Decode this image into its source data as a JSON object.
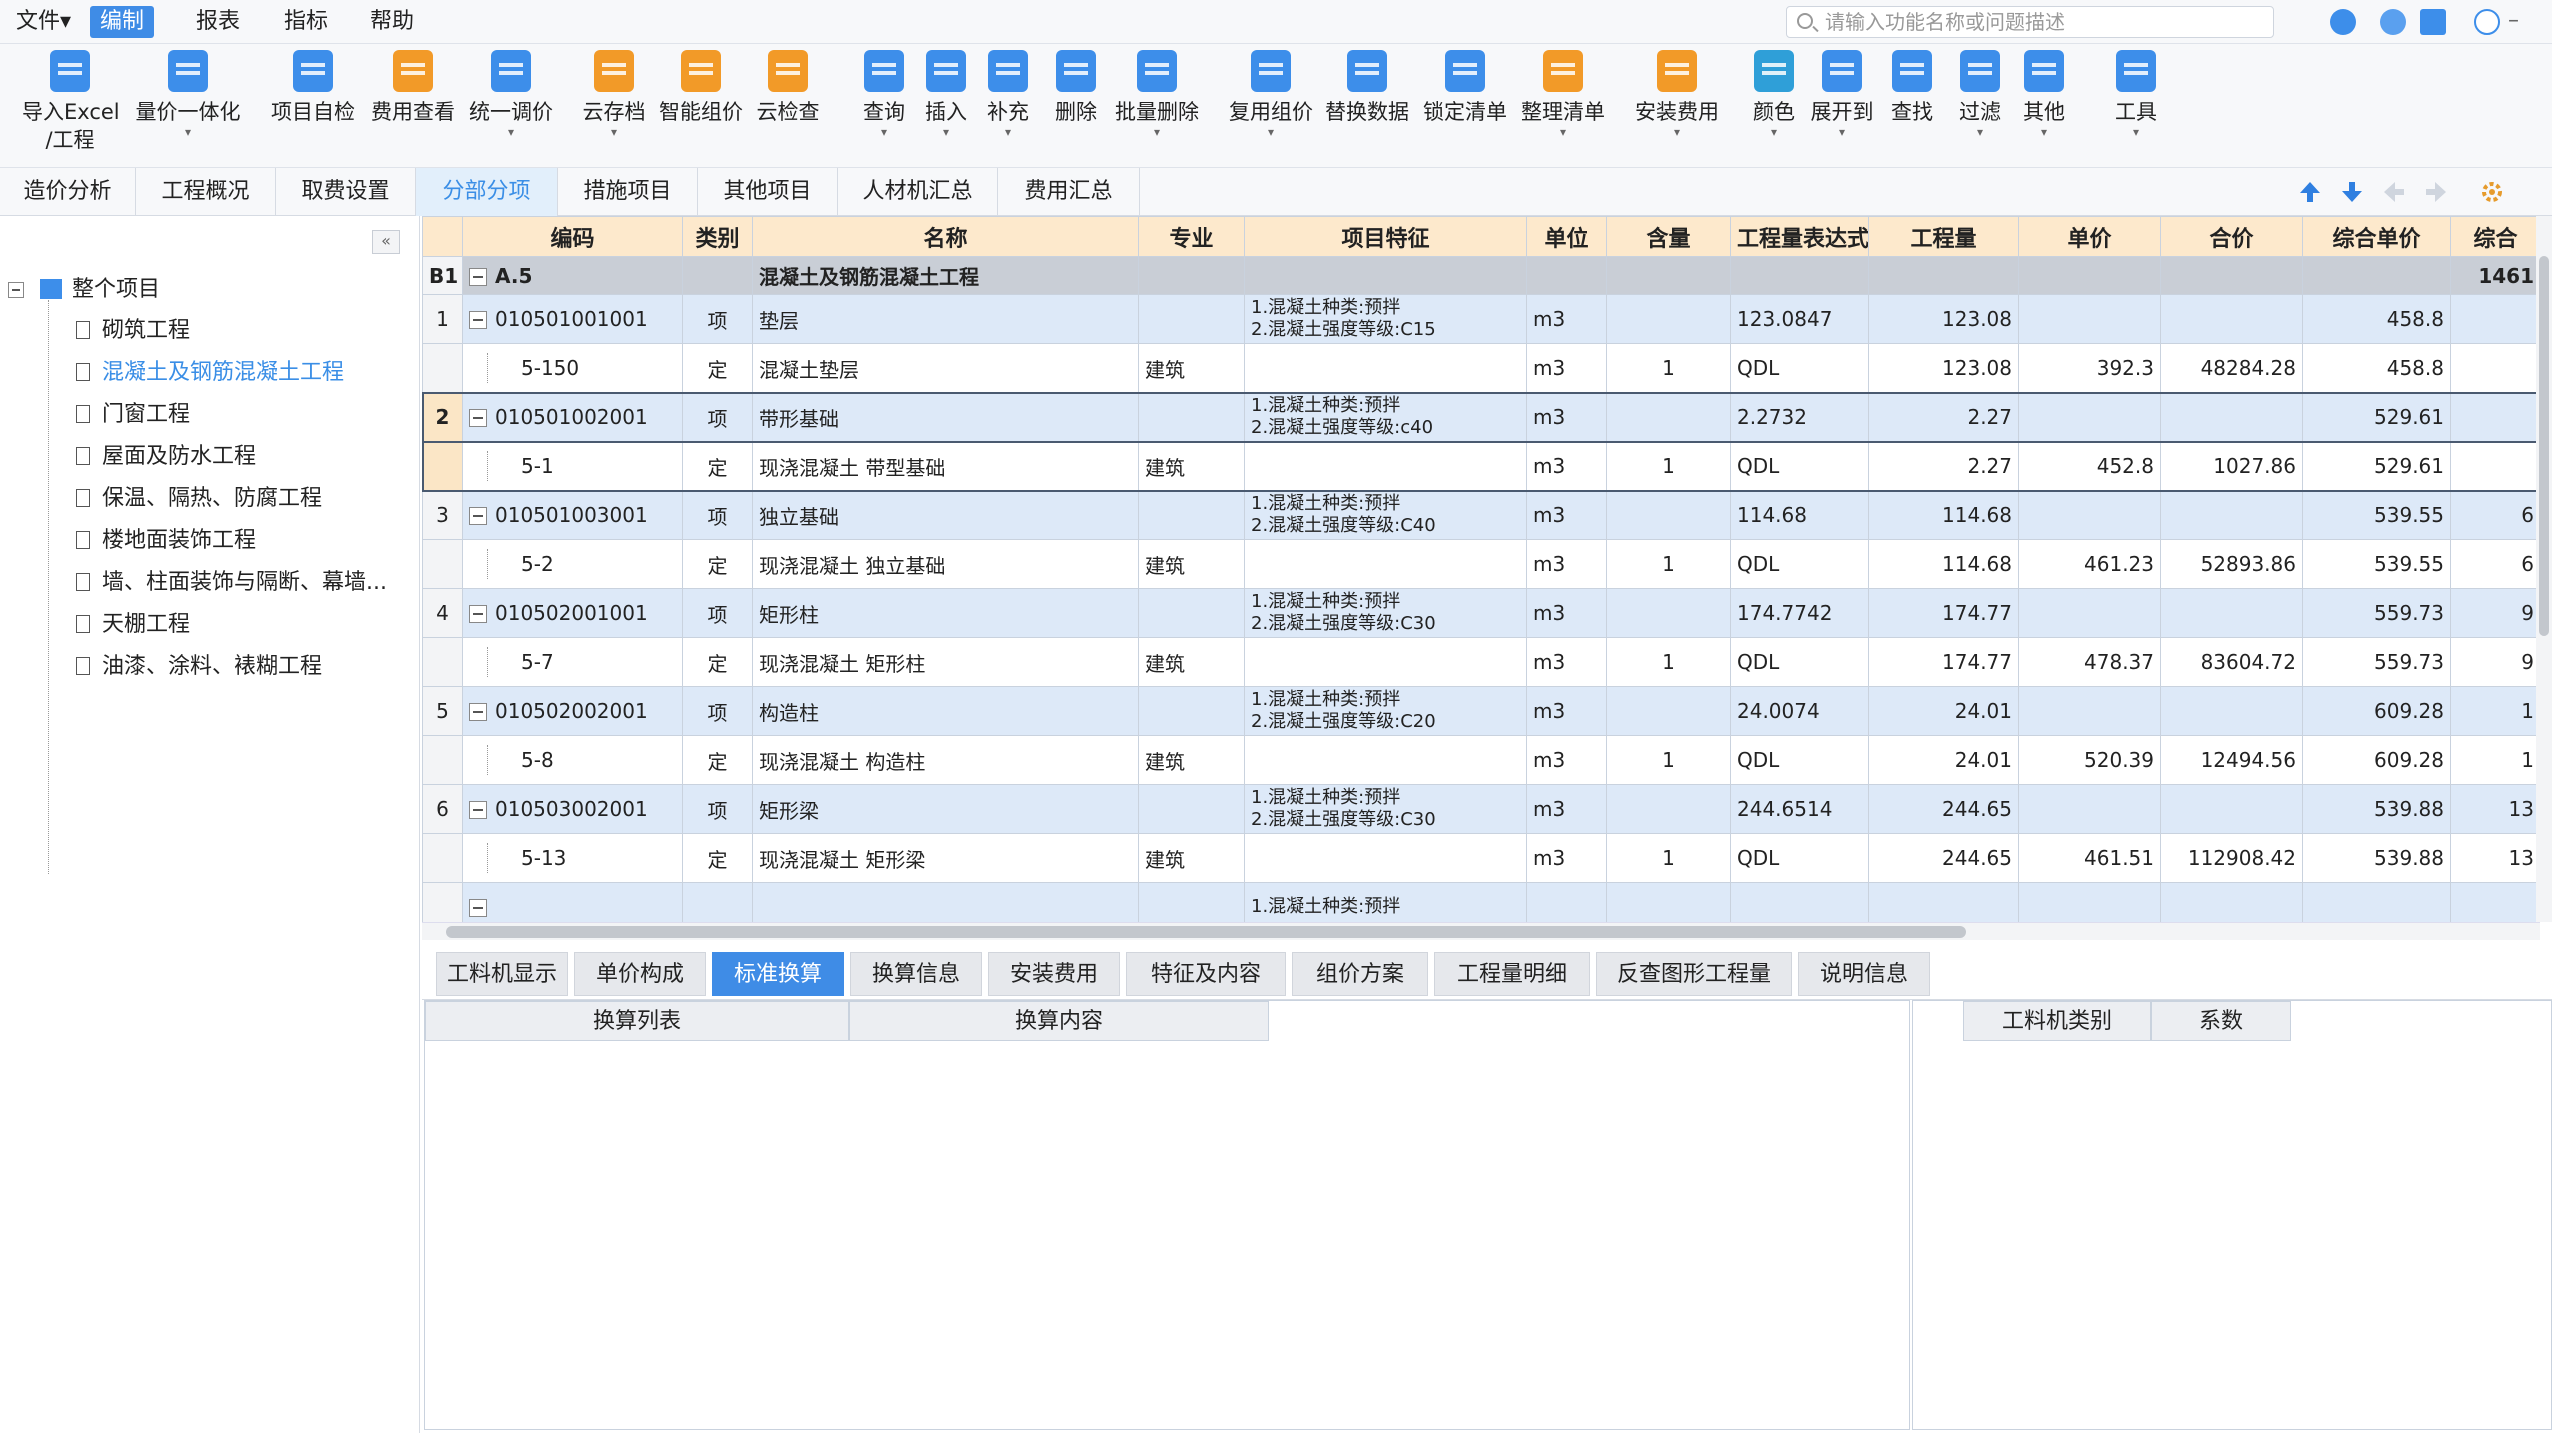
{
  "menu": {
    "items": [
      "文件",
      "编制",
      "报表",
      "指标",
      "帮助"
    ],
    "file_label": "文件▾",
    "search_placeholder": "请输入功能名称或问题描述"
  },
  "ribbon": {
    "tools": [
      {
        "label": "导入Excel",
        "label2": "/工程",
        "dd": "▾"
      },
      {
        "label": "量价一体化",
        "dd": "▾"
      },
      {
        "label": "项目自检",
        "dd": ""
      },
      {
        "label": "费用查看",
        "dd": ""
      },
      {
        "label": "统一调价",
        "dd": "▾"
      },
      {
        "label": "云存档",
        "dd": "▾"
      },
      {
        "label": "智能组价",
        "dd": ""
      },
      {
        "label": "云检查",
        "dd": ""
      },
      {
        "label": "查询",
        "dd": "▾"
      },
      {
        "label": "插入",
        "dd": "▾"
      },
      {
        "label": "补充",
        "dd": "▾"
      },
      {
        "label": "删除",
        "dd": ""
      },
      {
        "label": "批量删除",
        "dd": "▾"
      },
      {
        "label": "复用组价",
        "dd": "▾"
      },
      {
        "label": "替换数据",
        "dd": ""
      },
      {
        "label": "锁定清单",
        "dd": ""
      },
      {
        "label": "整理清单",
        "dd": "▾"
      },
      {
        "label": "安装费用",
        "dd": "▾"
      },
      {
        "label": "颜色",
        "dd": "▾"
      },
      {
        "label": "展开到",
        "dd": "▾"
      },
      {
        "label": "查找",
        "dd": ""
      },
      {
        "label": "过滤",
        "dd": "▾"
      },
      {
        "label": "其他",
        "dd": "▾"
      },
      {
        "label": "工具",
        "dd": "▾"
      }
    ]
  },
  "page_tabs": [
    "造价分析",
    "工程概况",
    "取费设置",
    "分部分项",
    "措施项目",
    "其他项目",
    "人材机汇总",
    "费用汇总"
  ],
  "tree": {
    "root": "整个项目",
    "items": [
      "砌筑工程",
      "混凝土及钢筋混凝土工程",
      "门窗工程",
      "屋面及防水工程",
      "保温、隔热、防腐工程",
      "楼地面装饰工程",
      "墙、柱面装饰与隔断、幕墙...",
      "天棚工程",
      "油漆、涂料、裱糊工程"
    ]
  },
  "grid": {
    "headers": [
      "",
      "编码",
      "类别",
      "名称",
      "专业",
      "项目特征",
      "单位",
      "含量",
      "工程量表达式",
      "工程量",
      "单价",
      "合价",
      "综合单价",
      "综合"
    ],
    "section": {
      "row": "B1",
      "code": "A.5",
      "name": "混凝土及钢筋混凝土工程",
      "total": "1461"
    },
    "rows": [
      {
        "type": "item",
        "no": "1",
        "code": "010501001001",
        "cat": "项",
        "name": "垫层",
        "spec": "",
        "feat1": "1.混凝土种类:预拌",
        "feat2": "2.混凝土强度等级:C15",
        "unit": "m3",
        "qty_ratio": "",
        "expr": "123.0847",
        "qty": "123.08",
        "price": "",
        "total": "",
        "unit_price": "458.8",
        "extra": ""
      },
      {
        "type": "sub",
        "no": "",
        "code": "5-150",
        "cat": "定",
        "name": "混凝土垫层",
        "spec": "建筑",
        "feat1": "",
        "feat2": "",
        "unit": "m3",
        "qty_ratio": "1",
        "expr": "QDL",
        "qty": "123.08",
        "price": "392.3",
        "total": "48284.28",
        "unit_price": "458.8",
        "extra": ""
      },
      {
        "type": "item",
        "no": "2",
        "code": "010501002001",
        "cat": "项",
        "name": "带形基础",
        "spec": "",
        "feat1": "1.混凝土种类:预拌",
        "feat2": "2.混凝土强度等级:c40",
        "unit": "m3",
        "qty_ratio": "",
        "expr": "2.2732",
        "qty": "2.27",
        "price": "",
        "total": "",
        "unit_price": "529.61",
        "extra": ""
      },
      {
        "type": "sub",
        "no": "",
        "code": "5-1",
        "cat": "定",
        "name": "现浇混凝土 带型基础",
        "spec": "建筑",
        "feat1": "",
        "feat2": "",
        "unit": "m3",
        "qty_ratio": "1",
        "expr": "QDL",
        "qty": "2.27",
        "price": "452.8",
        "total": "1027.86",
        "unit_price": "529.61",
        "extra": ""
      },
      {
        "type": "item",
        "no": "3",
        "code": "010501003001",
        "cat": "项",
        "name": "独立基础",
        "spec": "",
        "feat1": "1.混凝土种类:预拌",
        "feat2": "2.混凝土强度等级:C40",
        "unit": "m3",
        "qty_ratio": "",
        "expr": "114.68",
        "qty": "114.68",
        "price": "",
        "total": "",
        "unit_price": "539.55",
        "extra": "6"
      },
      {
        "type": "sub",
        "no": "",
        "code": "5-2",
        "cat": "定",
        "name": "现浇混凝土 独立基础",
        "spec": "建筑",
        "feat1": "",
        "feat2": "",
        "unit": "m3",
        "qty_ratio": "1",
        "expr": "QDL",
        "qty": "114.68",
        "price": "461.23",
        "total": "52893.86",
        "unit_price": "539.55",
        "extra": "6"
      },
      {
        "type": "item",
        "no": "4",
        "code": "010502001001",
        "cat": "项",
        "name": "矩形柱",
        "spec": "",
        "feat1": "1.混凝土种类:预拌",
        "feat2": "2.混凝土强度等级:C30",
        "unit": "m3",
        "qty_ratio": "",
        "expr": "174.7742",
        "qty": "174.77",
        "price": "",
        "total": "",
        "unit_price": "559.73",
        "extra": "9"
      },
      {
        "type": "sub",
        "no": "",
        "code": "5-7",
        "cat": "定",
        "name": "现浇混凝土 矩形柱",
        "spec": "建筑",
        "feat1": "",
        "feat2": "",
        "unit": "m3",
        "qty_ratio": "1",
        "expr": "QDL",
        "qty": "174.77",
        "price": "478.37",
        "total": "83604.72",
        "unit_price": "559.73",
        "extra": "9"
      },
      {
        "type": "item",
        "no": "5",
        "code": "010502002001",
        "cat": "项",
        "name": "构造柱",
        "spec": "",
        "feat1": "1.混凝土种类:预拌",
        "feat2": "2.混凝土强度等级:C20",
        "unit": "m3",
        "qty_ratio": "",
        "expr": "24.0074",
        "qty": "24.01",
        "price": "",
        "total": "",
        "unit_price": "609.28",
        "extra": "1"
      },
      {
        "type": "sub",
        "no": "",
        "code": "5-8",
        "cat": "定",
        "name": "现浇混凝土 构造柱",
        "spec": "建筑",
        "feat1": "",
        "feat2": "",
        "unit": "m3",
        "qty_ratio": "1",
        "expr": "QDL",
        "qty": "24.01",
        "price": "520.39",
        "total": "12494.56",
        "unit_price": "609.28",
        "extra": "1"
      },
      {
        "type": "item",
        "no": "6",
        "code": "010503002001",
        "cat": "项",
        "name": "矩形梁",
        "spec": "",
        "feat1": "1.混凝土种类:预拌",
        "feat2": "2.混凝土强度等级:C30",
        "unit": "m3",
        "qty_ratio": "",
        "expr": "244.6514",
        "qty": "244.65",
        "price": "",
        "total": "",
        "unit_price": "539.88",
        "extra": "13"
      },
      {
        "type": "sub",
        "no": "",
        "code": "5-13",
        "cat": "定",
        "name": "现浇混凝土 矩形梁",
        "spec": "建筑",
        "feat1": "",
        "feat2": "",
        "unit": "m3",
        "qty_ratio": "1",
        "expr": "QDL",
        "qty": "244.65",
        "price": "461.51",
        "total": "112908.42",
        "unit_price": "539.88",
        "extra": "13"
      },
      {
        "type": "item",
        "no": "",
        "code": "",
        "cat": "",
        "name": "",
        "spec": "",
        "feat1": "1.混凝土种类:预拌",
        "feat2": "",
        "unit": "",
        "qty_ratio": "",
        "expr": "",
        "qty": "",
        "price": "",
        "total": "",
        "unit_price": "",
        "extra": ""
      }
    ]
  },
  "bottom_tabs": [
    "工料机显示",
    "单价构成",
    "标准换算",
    "换算信息",
    "安装费用",
    "特征及内容",
    "组价方案",
    "工程量明细",
    "反查图形工程量",
    "说明信息"
  ],
  "bottom_left_headers": [
    "换算列表",
    "换算内容"
  ],
  "bottom_right_headers": [
    "工料机类别",
    "系数"
  ]
}
